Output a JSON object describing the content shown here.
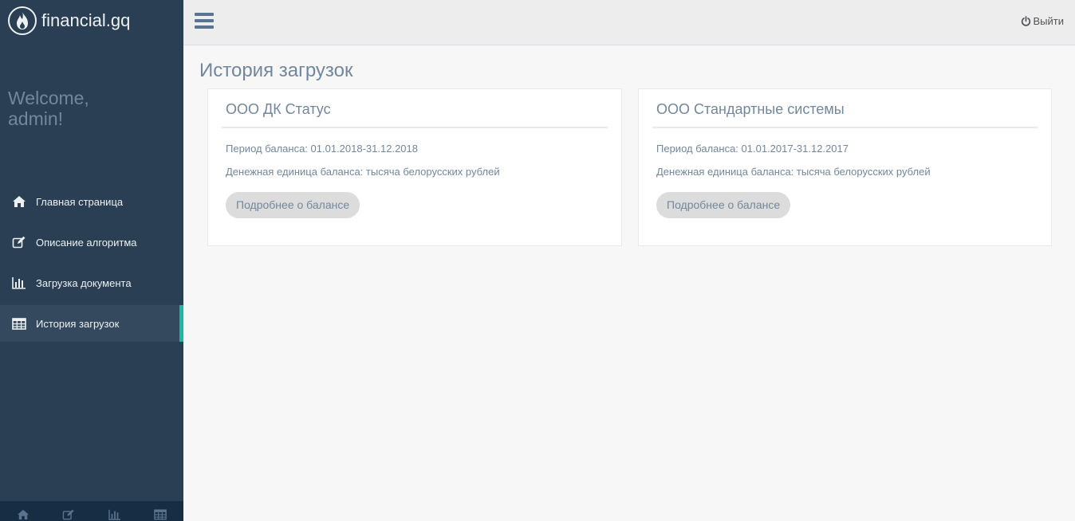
{
  "app": {
    "brand": "financial.gq"
  },
  "sidebar": {
    "welcome": [
      "Welcome,",
      "admin!"
    ],
    "items": [
      {
        "label": "Главная страница",
        "icon": "home-icon"
      },
      {
        "label": "Описание алгоритма",
        "icon": "edit-icon"
      },
      {
        "label": "Загрузка документа",
        "icon": "bar-chart-icon"
      },
      {
        "label": "История загрузок",
        "icon": "table-icon",
        "active": true
      }
    ],
    "footer_icons": [
      "home-icon",
      "edit-icon",
      "bar-chart-icon",
      "table-icon"
    ]
  },
  "topnav": {
    "logout_label": "Выйти"
  },
  "page": {
    "title": "История загрузок"
  },
  "cards": [
    {
      "title": "ООО ДК Статус",
      "period": "Период баланса: 01.01.2018-31.12.2018",
      "unit": "Денежная единица баланса: тысяча белорусских рублей",
      "button": "Подробнее о балансе"
    },
    {
      "title": "ООО Стандартные системы",
      "period": "Период баланса: 01.01.2017-31.12.2017",
      "unit": "Денежная единица баланса: тысяча белорусских рублей",
      "button": "Подробнее о балансе"
    }
  ],
  "colors": {
    "sidebar": "#2a3f54",
    "accent": "#1abb9c",
    "text": "#73879c"
  }
}
